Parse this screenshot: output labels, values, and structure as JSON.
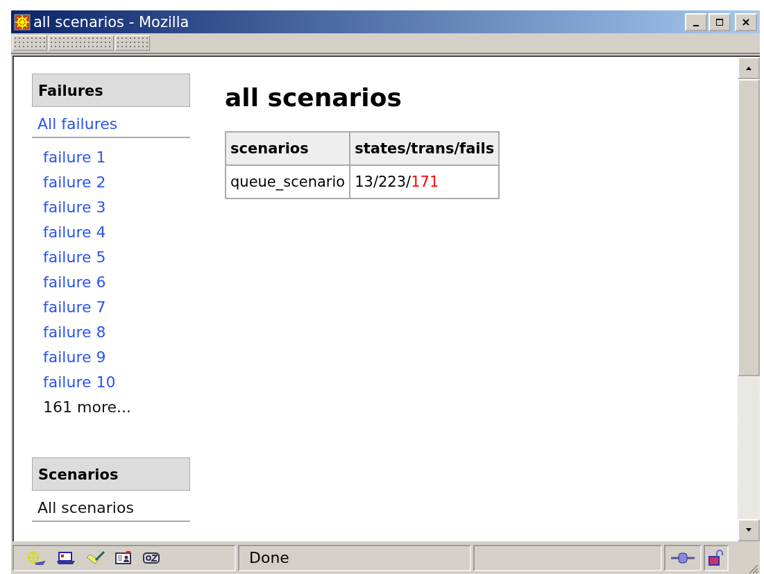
{
  "window": {
    "title": "all scenarios - Mozilla"
  },
  "sidebar": {
    "sections": [
      {
        "heading": "Failures",
        "top_link": {
          "label": "All failures",
          "kind": "link"
        },
        "items": [
          {
            "label": "failure 1",
            "kind": "link"
          },
          {
            "label": "failure 2",
            "kind": "link"
          },
          {
            "label": "failure 3",
            "kind": "link"
          },
          {
            "label": "failure 4",
            "kind": "link"
          },
          {
            "label": "failure 5",
            "kind": "link"
          },
          {
            "label": "failure 6",
            "kind": "link"
          },
          {
            "label": "failure 7",
            "kind": "link"
          },
          {
            "label": "failure 8",
            "kind": "link"
          },
          {
            "label": "failure 9",
            "kind": "link"
          },
          {
            "label": "failure 10",
            "kind": "link"
          },
          {
            "label": "161 more...",
            "kind": "text"
          }
        ]
      },
      {
        "heading": "Scenarios",
        "top_link": {
          "label": "All scenarios",
          "kind": "text"
        }
      }
    ]
  },
  "page": {
    "heading": "all scenarios",
    "table": {
      "columns": [
        "scenarios",
        "states/trans/fails"
      ],
      "rows": [
        {
          "scenario": "queue_scenario",
          "counts": "13/223/",
          "fails": "171"
        }
      ]
    }
  },
  "status_bar": {
    "text": "Done"
  }
}
